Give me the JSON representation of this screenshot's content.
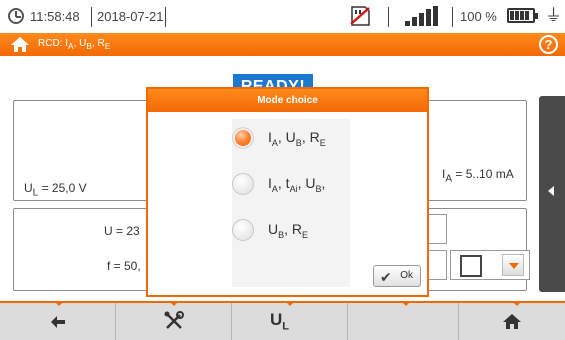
{
  "status_bar": {
    "time": "11:58:48",
    "date": "2018-07-21",
    "battery_percent": "100 %",
    "icons": [
      "clock-icon",
      "sd-card-icon",
      "signal-icon",
      "battery-icon",
      "plug-icon"
    ]
  },
  "header": {
    "title": "RCD: IA, UB, RE",
    "icons": [
      "home-icon",
      "help-icon"
    ],
    "colors": {
      "bar": "#f26a05",
      "text": "#ffffff"
    }
  },
  "status_badge": {
    "text": "READY!",
    "color": "#1d79d0"
  },
  "measurements": {
    "ul": "UL = 25,0 V",
    "ia": "IA = 5..10 mA",
    "u": "U = 23",
    "f": "f = 50,"
  },
  "modal": {
    "title": "Mode choice",
    "options": [
      {
        "label": "IA, UB, RE",
        "selected": true
      },
      {
        "label": "IA, tAi, UB,",
        "selected": false
      },
      {
        "label": "UB, RE",
        "selected": false
      }
    ],
    "ok_label": "Ok"
  },
  "toolbar": {
    "buttons": [
      "back-arrow-icon",
      "settings-tools-icon",
      "UL",
      "",
      "home-icon"
    ],
    "ul_label": "UL"
  },
  "help_glyph": "?",
  "colors": {
    "accent": "#f26a05",
    "toolbar_bg": "#dcdcdc",
    "side_tab": "#4a4a4a"
  }
}
